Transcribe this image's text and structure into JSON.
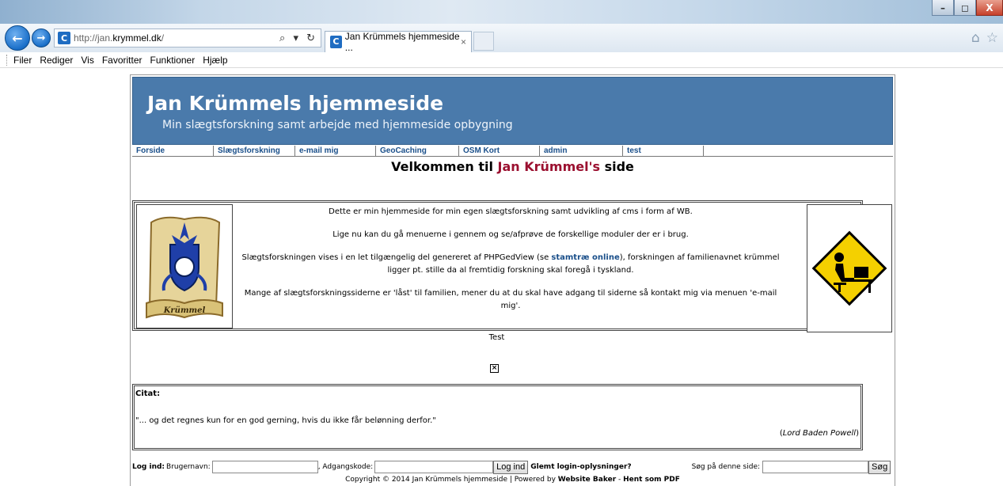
{
  "browser": {
    "address": {
      "protocol": "http://jan.",
      "domain": "krymmel.dk",
      "path": "/"
    },
    "address_tools": "⌕ ▾ ↻",
    "tab_title": "Jan Krümmels hjemmeside ...",
    "tab_close": "×",
    "back_icon": "←",
    "forward_icon": "→",
    "home_icon": "⌂",
    "star_icon": "☆",
    "window_controls": [
      "–",
      "◻",
      "X"
    ]
  },
  "menubar": {
    "items": [
      "Filer",
      "Rediger",
      "Vis",
      "Favoritter",
      "Funktioner",
      "Hjælp"
    ]
  },
  "site": {
    "title": "Jan Krümmels hjemmeside",
    "subtitle": "Min slægtsforskning samt arbejde med hjemmeside opbygning",
    "nav": [
      "Forside",
      "Slægtsforskning",
      "e-mail mig",
      "GeoCaching",
      "OSM Kort",
      "admin",
      "test"
    ],
    "welcome_prefix": "Velkommen til ",
    "welcome_name": "Jan Krümmel's",
    "welcome_suffix": " side",
    "intro": {
      "p1": "Dette er min hjemmeside for min egen slægtsforskning samt udvikling af cms i form af WB.",
      "p2": "Lige nu kan du gå menuerne i gennem og se/afprøve de forskellige moduler der er i brug.",
      "p3_a": "Slægtsforskningen vises i en let tilgængelig del genereret af PHPGedView (se ",
      "p3_link": "stamtræ online",
      "p3_b": "), forskningen af familienavnet krümmel ligger pt. stille da al fremtidig forskning skal foregå i tyskland.",
      "p4": "Mange af slægtsforskningssiderne er 'låst' til familien, mener du at du skal have adgang til siderne så kontakt mig via menuen 'e-mail mig'."
    },
    "crest_label": "Krümmel",
    "test_label": "Test",
    "broken_image_glyph": "×",
    "citat": {
      "label": "Citat:",
      "text": "\"... og det regnes kun for en god gerning, hvis du ikke får belønning derfor.\"",
      "author_open": "(",
      "author": "Lord Baden Powell",
      "author_close": ")"
    },
    "login": {
      "label": "Log ind:",
      "username_label": "Brugernavn:",
      "password_label": ", Adgangskode:",
      "button": "Log ind",
      "forgot": "Glemt login-oplysninger?",
      "search_label": "Søg på denne side:",
      "search_button": "Søg"
    },
    "copyright": {
      "text": "Copyright © 2014 Jan Krümmels hjemmeside | Powered by ",
      "wb": "Website Baker",
      "sep": " - ",
      "pdf": "Hent som PDF"
    }
  }
}
